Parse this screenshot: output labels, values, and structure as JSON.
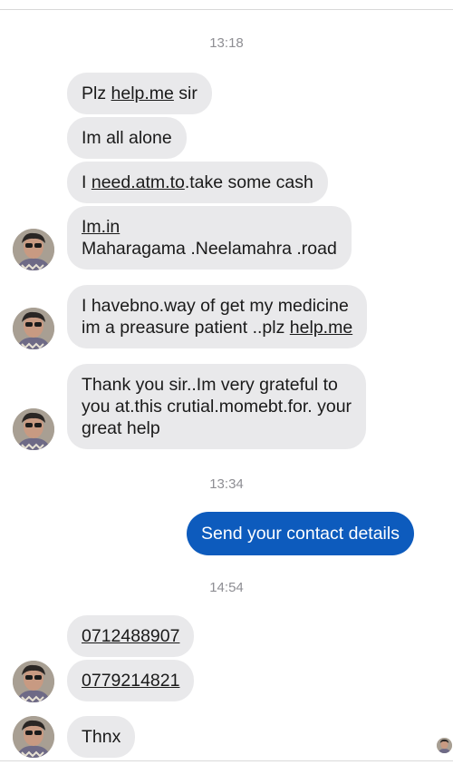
{
  "chat": {
    "timestamps": [
      "13:18",
      "13:34",
      "14:54"
    ],
    "incoming": {
      "m1_pre": "Plz ",
      "m1_link": "help.me",
      "m1_post": " sir",
      "m2": "Im all alone",
      "m3_pre": "I  ",
      "m3_link": "need.atm.to",
      "m3_post": ".take some cash",
      "m4_link": "Im.in",
      "m4_line2": "Maharagama .Neelamahra .road",
      "m5_line1": "I havebno.way of get my medicine",
      "m5_line2_pre": "im a preasure patient ..plz ",
      "m5_line2_link": "help.me",
      "m6_line1": "Thank you sir..Im very grateful to",
      "m6_line2": "you at.this crutial.momebt.for. your",
      "m6_line3": "great help",
      "m7_phone": "0712488907",
      "m8_phone": "0779214821",
      "m9": "Thnx"
    },
    "outgoing": {
      "m1": "Send your contact details"
    }
  },
  "colors": {
    "incoming_bubble": "#e9e9eb",
    "outgoing_bubble": "#0d5bbd",
    "timestamp": "#8e8e93"
  },
  "icons": {
    "avatar": "contact-avatar-icon",
    "read_receipt": "read-receipt-avatar-icon"
  }
}
